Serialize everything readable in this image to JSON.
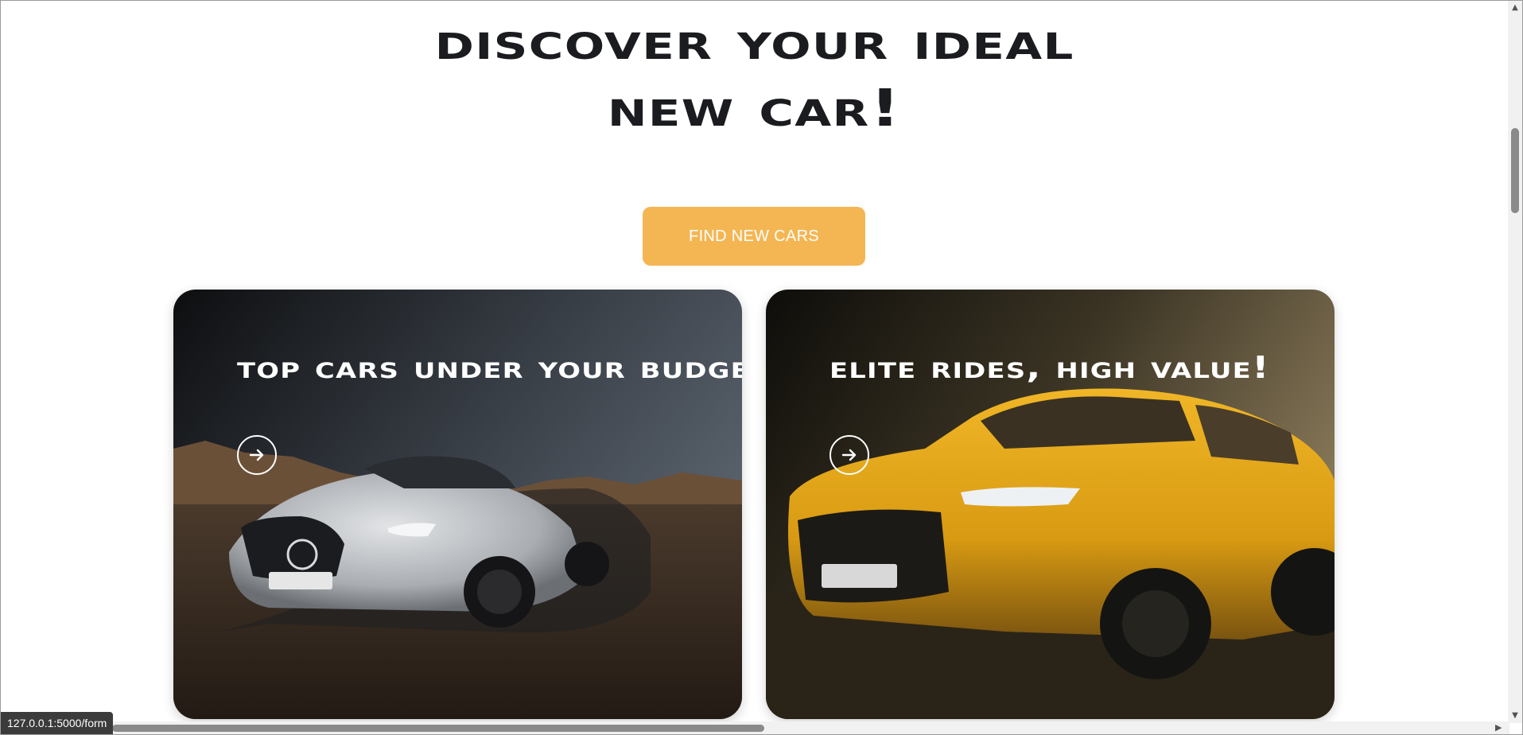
{
  "hero": {
    "line1": "Discover Your Ideal",
    "line2": "New Car!"
  },
  "cta": {
    "label": "FIND NEW CARS"
  },
  "cards": [
    {
      "title": "Top Cars Under Your Budget!",
      "arrow_icon": "arrow-right-circle-icon"
    },
    {
      "title": "Elite Rides, High Value!",
      "arrow_icon": "arrow-right-circle-icon"
    }
  ],
  "status_bar": {
    "url": "127.0.0.1:5000/form"
  },
  "colors": {
    "accent": "#f4b653",
    "heading": "#1b1c20"
  }
}
